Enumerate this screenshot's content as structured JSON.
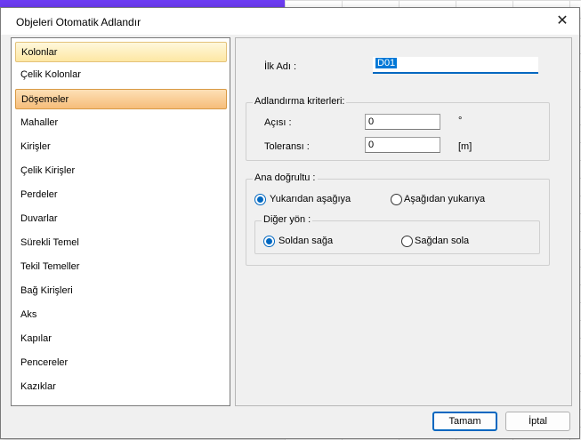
{
  "window": {
    "title": "Objeleri Otomatik Adlandır"
  },
  "list": {
    "items": [
      {
        "label": "Kolonlar",
        "state": "selected-light"
      },
      {
        "label": "Çelik Kolonlar",
        "state": "normal"
      },
      {
        "label": "Döşemeler",
        "state": "selected"
      },
      {
        "label": "Mahaller",
        "state": "normal"
      },
      {
        "label": "Kirişler",
        "state": "normal"
      },
      {
        "label": "Çelik Kirişler",
        "state": "normal"
      },
      {
        "label": "Perdeler",
        "state": "normal"
      },
      {
        "label": "Duvarlar",
        "state": "normal"
      },
      {
        "label": "Sürekli Temel",
        "state": "normal"
      },
      {
        "label": "Tekil Temeller",
        "state": "normal"
      },
      {
        "label": "Bağ Kirişleri",
        "state": "normal"
      },
      {
        "label": "Aks",
        "state": "normal"
      },
      {
        "label": "Kapılar",
        "state": "normal"
      },
      {
        "label": "Pencereler",
        "state": "normal"
      },
      {
        "label": "Kazıklar",
        "state": "normal"
      }
    ]
  },
  "form": {
    "first_name_label": "İlk Adı :",
    "first_name_value": "D01",
    "criteria_title": "Adlandırma kriterleri:",
    "angle_label": "Açısı :",
    "angle_value": "0",
    "angle_unit": "°",
    "tolerance_label": "Toleransı :",
    "tolerance_value": "0",
    "tolerance_unit": "[m]",
    "main_dir_title": "Ana doğrultu  :",
    "top_down_label": "Yukarıdan aşağıya",
    "bottom_up_label": "Aşağıdan yukarıya",
    "other_dir_title": "Diğer yön  :",
    "left_right_label": "Soldan sağa",
    "right_left_label": "Sağdan sola"
  },
  "buttons": {
    "ok": "Tamam",
    "cancel": "İptal"
  },
  "colors": {
    "accent": "#0067c0",
    "selection": "#f6bd7a"
  }
}
